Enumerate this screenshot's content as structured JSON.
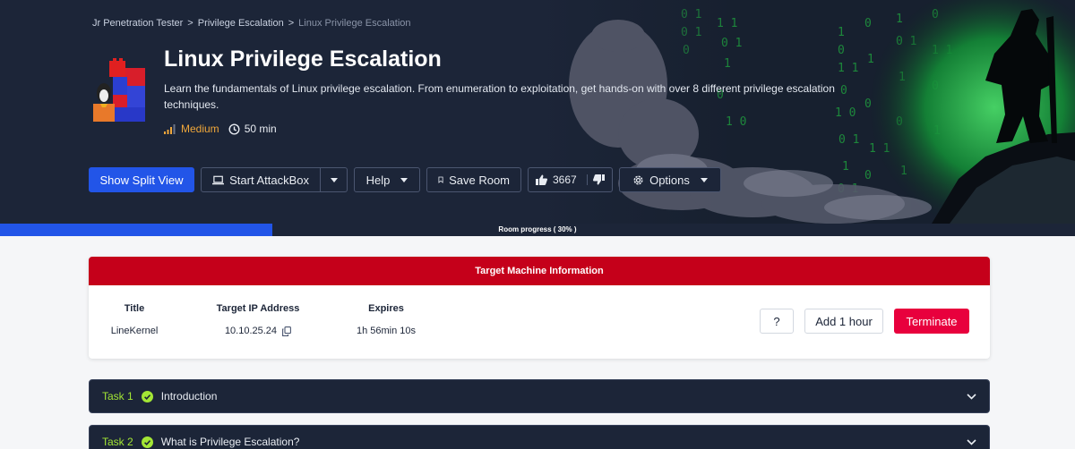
{
  "breadcrumb": {
    "items": [
      "Jr Penetration Tester",
      "Privilege Escalation"
    ],
    "current": "Linux Privilege Escalation",
    "separator": ">"
  },
  "room": {
    "title": "Linux Privilege Escalation",
    "description": "Learn the fundamentals of Linux privilege escalation. From enumeration to exploitation, get hands-on with over 8 different privilege escalation techniques.",
    "difficulty": "Medium",
    "duration": "50 min"
  },
  "toolbar": {
    "split_view_label": "Show Split View",
    "attackbox_label": "Start AttackBox",
    "help_label": "Help",
    "save_label": "Save Room",
    "likes": "3667",
    "options_label": "Options"
  },
  "progress": {
    "label": "Room progress ( 30% )",
    "percent": 25.3
  },
  "machine": {
    "header": "Target Machine Information",
    "columns": [
      {
        "label": "Title",
        "value": "LineKernel"
      },
      {
        "label": "Target IP Address",
        "value": "10.10.25.24"
      },
      {
        "label": "Expires",
        "value": "1h 56min 10s"
      }
    ],
    "help_label": "?",
    "add_label": "Add 1 hour",
    "terminate_label": "Terminate"
  },
  "tasks": [
    {
      "number": "Task 1",
      "title": "Introduction"
    },
    {
      "number": "Task 2",
      "title": "What is Privilege Escalation?"
    }
  ],
  "colors": {
    "hero_bg": "#1c2538",
    "accent_blue": "#2255e8",
    "machine_header_red": "#c5001a",
    "terminate_red": "#e8003d",
    "task_green": "#a3e635",
    "difficulty_orange": "#f0a73a"
  },
  "icons": {
    "difficulty": "signal-bars-icon",
    "duration": "clock-icon",
    "attackbox": "laptop-icon",
    "save": "bookmark-icon",
    "like": "thumbs-up-icon",
    "dislike": "thumbs-down-icon",
    "options": "gear-icon",
    "copy": "copy-icon",
    "task_done": "check-circle-icon",
    "expand": "chevron-down-icon"
  }
}
